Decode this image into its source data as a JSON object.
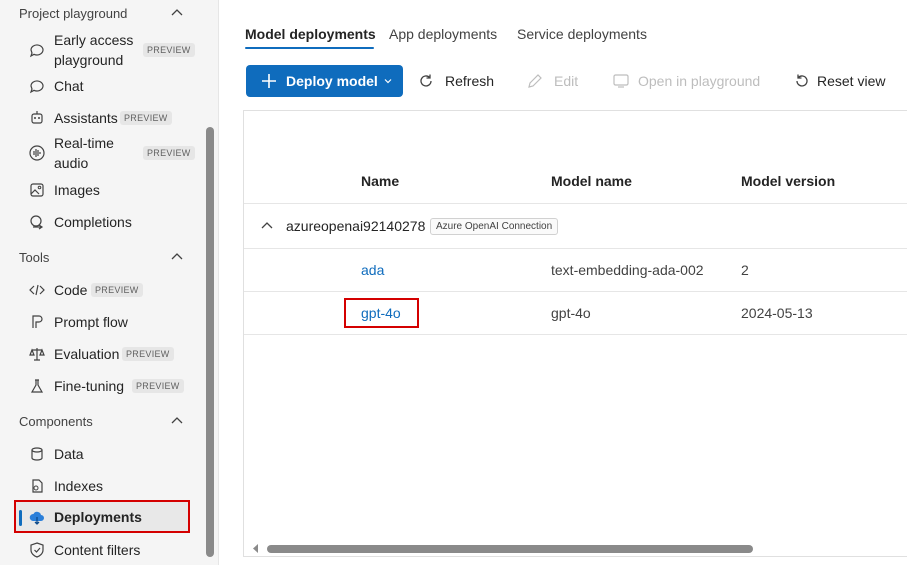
{
  "sidebar": {
    "sections": [
      {
        "label": "Project playground"
      },
      {
        "label": "Tools"
      },
      {
        "label": "Components"
      }
    ],
    "items": [
      {
        "label": "Early access playground",
        "badge": "PREVIEW",
        "icon": "chat-sparkle-icon"
      },
      {
        "label": "Chat",
        "icon": "chat-icon"
      },
      {
        "label": "Assistants",
        "badge": "PREVIEW",
        "icon": "assistant-icon"
      },
      {
        "label": "Real-time audio",
        "badge": "PREVIEW",
        "icon": "audio-wave-icon"
      },
      {
        "label": "Images",
        "icon": "image-icon"
      },
      {
        "label": "Completions",
        "icon": "completions-icon"
      },
      {
        "label": "Code",
        "badge": "PREVIEW",
        "icon": "code-icon"
      },
      {
        "label": "Prompt flow",
        "icon": "prompt-flow-icon"
      },
      {
        "label": "Evaluation",
        "badge": "PREVIEW",
        "icon": "scale-icon"
      },
      {
        "label": "Fine-tuning",
        "badge": "PREVIEW",
        "icon": "flask-icon"
      },
      {
        "label": "Data",
        "icon": "database-icon"
      },
      {
        "label": "Indexes",
        "icon": "indexes-icon"
      },
      {
        "label": "Deployments",
        "icon": "cloud-deploy-icon"
      },
      {
        "label": "Content filters",
        "icon": "shield-icon"
      }
    ]
  },
  "tabs": [
    {
      "label": "Model deployments"
    },
    {
      "label": "App deployments"
    },
    {
      "label": "Service deployments"
    }
  ],
  "toolbar": {
    "deploy": "Deploy model",
    "refresh": "Refresh",
    "edit": "Edit",
    "open_playground": "Open in playground",
    "reset_view": "Reset view"
  },
  "table": {
    "columns": [
      "Name",
      "Model name",
      "Model version"
    ],
    "group": {
      "name": "azureopenai92140278",
      "tag": "Azure OpenAI Connection"
    },
    "rows": [
      {
        "name": "ada",
        "model": "text-embedding-ada-002",
        "version": "2"
      },
      {
        "name": "gpt-4o",
        "model": "gpt-4o",
        "version": "2024-05-13"
      }
    ]
  },
  "colors": {
    "accent": "#0f6cbd",
    "highlight": "#d40000"
  }
}
